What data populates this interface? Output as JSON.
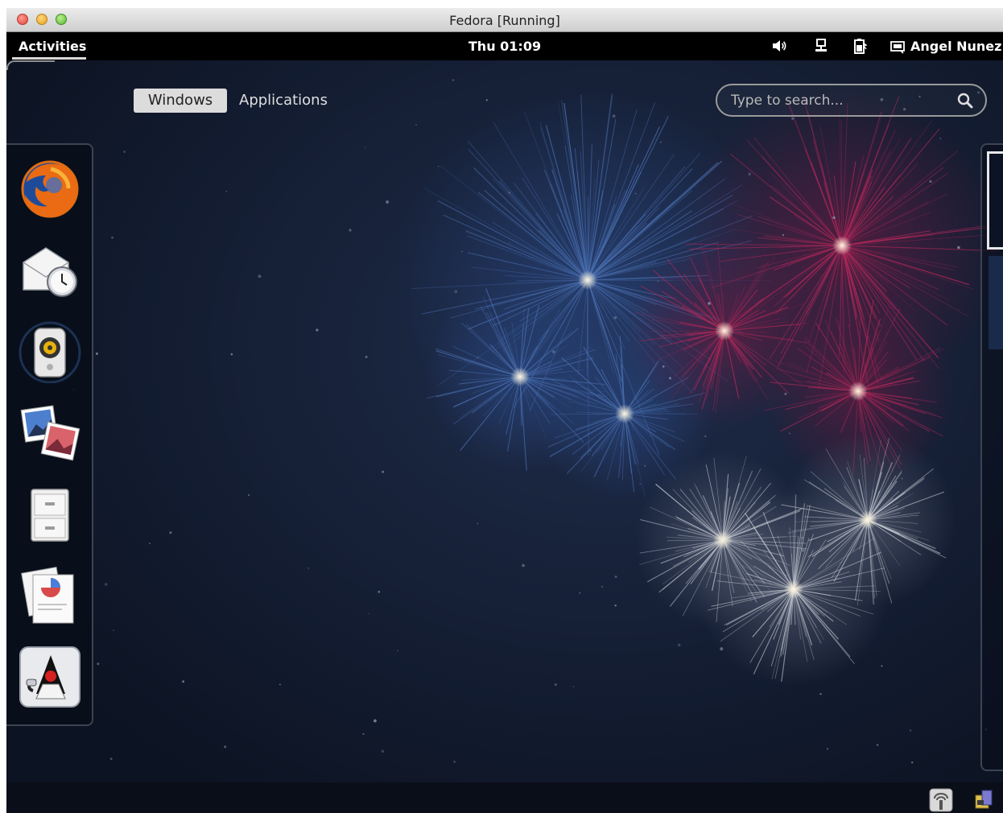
{
  "window": {
    "title": "Fedora [Running]"
  },
  "topbar": {
    "activities_label": "Activities",
    "clock": "Thu 01:09",
    "user_name": "Angel Nunez",
    "tray_icons": [
      "volume-icon",
      "network-icon",
      "battery-icon",
      "user-status-icon"
    ]
  },
  "overview": {
    "tabs": [
      {
        "label": "Windows",
        "selected": true
      },
      {
        "label": "Applications",
        "selected": false
      }
    ],
    "search": {
      "placeholder": "Type to search..."
    }
  },
  "dash": {
    "items": [
      {
        "icon": "firefox-icon"
      },
      {
        "icon": "evolution-mail-icon"
      },
      {
        "icon": "rhythmbox-icon"
      },
      {
        "icon": "shotwell-photos-icon"
      },
      {
        "icon": "file-manager-icon"
      },
      {
        "icon": "office-document-icon"
      },
      {
        "icon": "java-duke-icon"
      }
    ]
  },
  "bottom_tray": [
    "accessibility-icon",
    "vbox-status-icon"
  ],
  "colors": {
    "background": "#0f1729",
    "firework_blue": "#4a6fb0",
    "firework_red": "#b0285a",
    "firework_white": "#c8ccd4"
  }
}
